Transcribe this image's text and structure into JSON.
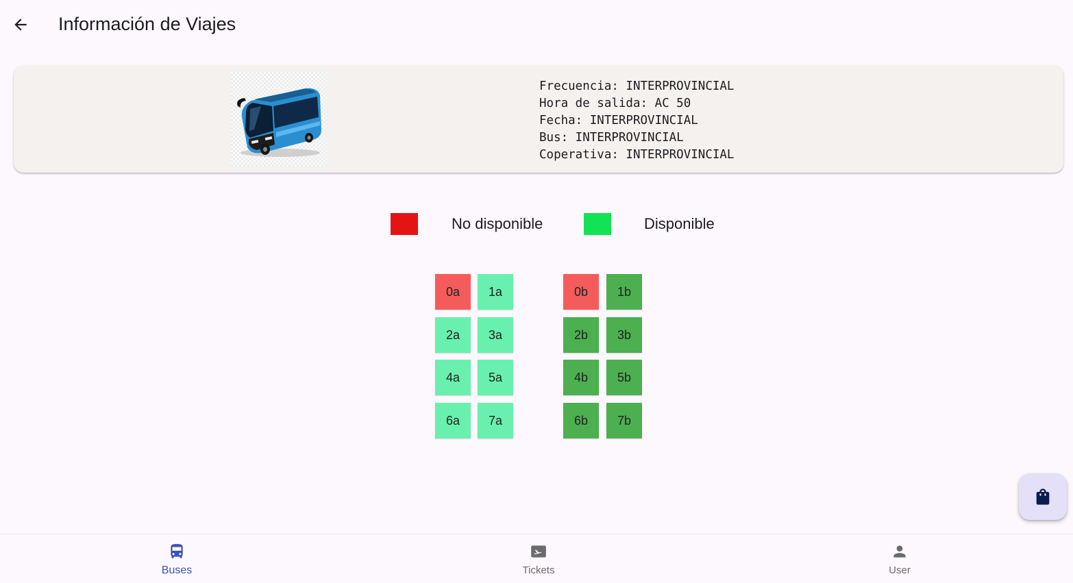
{
  "app_bar": {
    "back_icon": "arrow-back-icon",
    "title": "Información de Viajes"
  },
  "trip_card": {
    "image_icon": "bus-photo",
    "details": [
      "Frecuencia: INTERPROVINCIAL",
      "Hora de salida: AC 50",
      "Fecha: INTERPROVINCIAL",
      "Bus: INTERPROVINCIAL",
      "Coperativa: INTERPROVINCIAL"
    ]
  },
  "legend": {
    "unavailable_label": "No disponible",
    "unavailable_color": "#e51414",
    "available_label": "Disponible",
    "available_color": "#11e354"
  },
  "seat_colors": {
    "occupied": "#f45c5c",
    "free_light": "#69f0ae",
    "free_dark": "#4caf50"
  },
  "seats": [
    {
      "label": "0a",
      "status": "occupied"
    },
    {
      "label": "1a",
      "status": "free_light"
    },
    {
      "label": "0b",
      "status": "occupied"
    },
    {
      "label": "1b",
      "status": "free_dark"
    },
    {
      "label": "2a",
      "status": "free_light"
    },
    {
      "label": "3a",
      "status": "free_light"
    },
    {
      "label": "2b",
      "status": "free_dark"
    },
    {
      "label": "3b",
      "status": "free_dark"
    },
    {
      "label": "4a",
      "status": "free_light"
    },
    {
      "label": "5a",
      "status": "free_light"
    },
    {
      "label": "4b",
      "status": "free_dark"
    },
    {
      "label": "5b",
      "status": "free_dark"
    },
    {
      "label": "6a",
      "status": "free_light"
    },
    {
      "label": "7a",
      "status": "free_light"
    },
    {
      "label": "6b",
      "status": "free_dark"
    },
    {
      "label": "7b",
      "status": "free_dark"
    }
  ],
  "fab": {
    "icon": "shopping-bag-icon",
    "color": "#0d1b4f"
  },
  "bottom_nav": {
    "active_color": "#3f51b5",
    "inactive_color": "#6b6b6b",
    "items": [
      {
        "label": "Buses",
        "icon": "bus-icon",
        "active": true
      },
      {
        "label": "Tickets",
        "icon": "ticket-flight-icon",
        "active": false
      },
      {
        "label": "User",
        "icon": "person-icon",
        "active": false
      }
    ]
  }
}
